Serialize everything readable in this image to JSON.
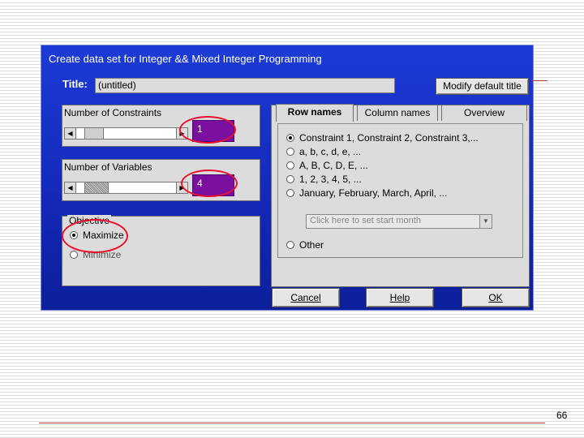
{
  "dialog": {
    "title": "Create data set for Integer && Mixed Integer Programming",
    "title_label": "Title:",
    "title_value": "(untitled)",
    "modify_button": "Modify default title"
  },
  "constraints": {
    "label": "Number of Constraints",
    "value": "1"
  },
  "variables": {
    "label": "Number of Variables",
    "value": "4"
  },
  "objective": {
    "label": "Objective",
    "options": [
      "Maximize",
      "Minimize"
    ],
    "selected": "Maximize"
  },
  "tabs": {
    "items": [
      "Row names",
      "Column names",
      "Overview"
    ],
    "active": "Row names"
  },
  "row_names": {
    "options": [
      "Constraint 1, Constraint 2, Constraint 3,...",
      "a, b, c, d, e, ...",
      "A, B, C, D, E, ...",
      "1, 2, 3, 4, 5, ...",
      "January, February, March, April, ...",
      "Other"
    ],
    "selected": "Constraint 1, Constraint 2, Constraint 3,...",
    "start_month_placeholder": "Click here to set start month"
  },
  "buttons": {
    "cancel": "Cancel",
    "help": "Help",
    "ok": "OK"
  },
  "annotation_color": "#e8112d",
  "page_number": "66"
}
